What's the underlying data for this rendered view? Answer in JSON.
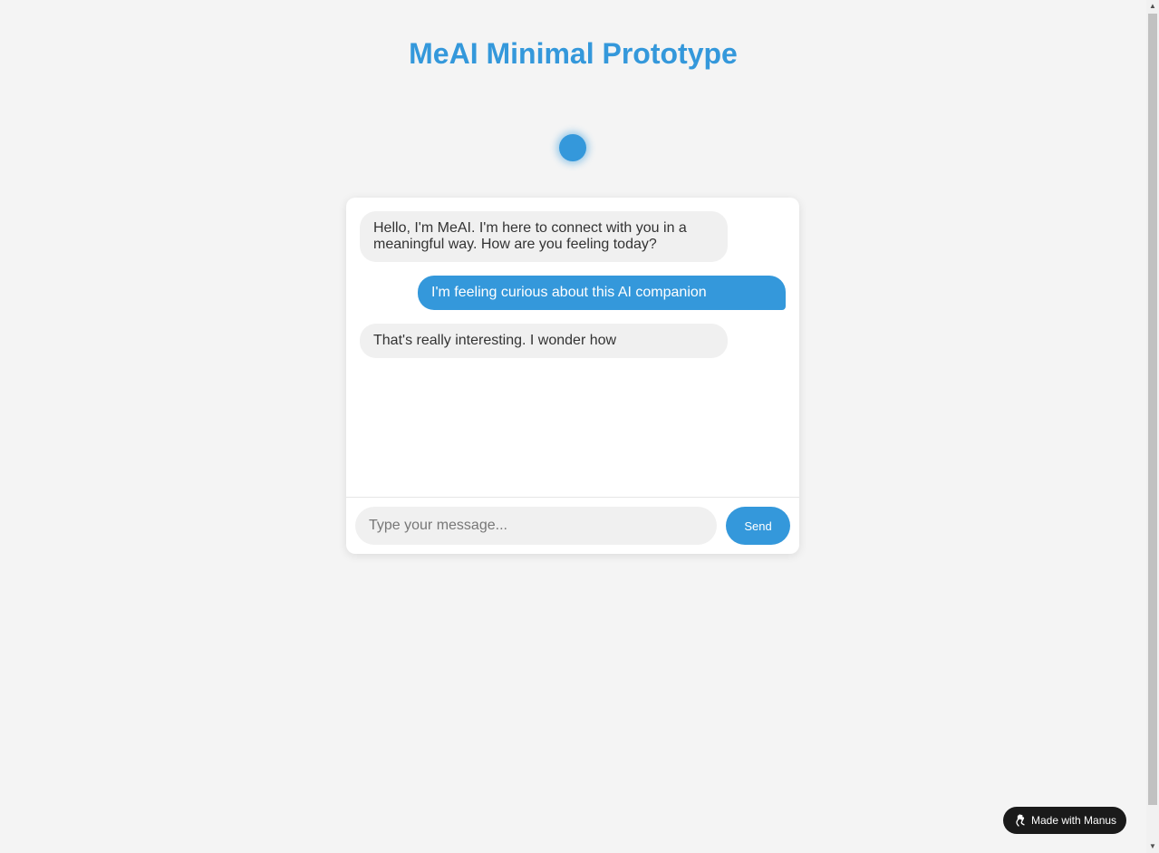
{
  "header": {
    "title": "MeAI Minimal Prototype"
  },
  "chat": {
    "messages": [
      {
        "sender": "ai",
        "text": "Hello, I'm MeAI. I'm here to connect with you in a meaningful way. How are you feeling today?"
      },
      {
        "sender": "user",
        "text": "I'm feeling curious about this AI companion"
      },
      {
        "sender": "ai",
        "text": "That's really interesting. I wonder how"
      }
    ],
    "input": {
      "value": "",
      "placeholder": "Type your message..."
    },
    "send_label": "Send"
  },
  "badge": {
    "label": "Made with Manus",
    "icon": "manus-hand-icon"
  },
  "colors": {
    "accent": "#3498db",
    "background": "#f4f4f4",
    "ai_bubble": "#f0f0f0",
    "badge_bg": "#1a1a1a"
  }
}
